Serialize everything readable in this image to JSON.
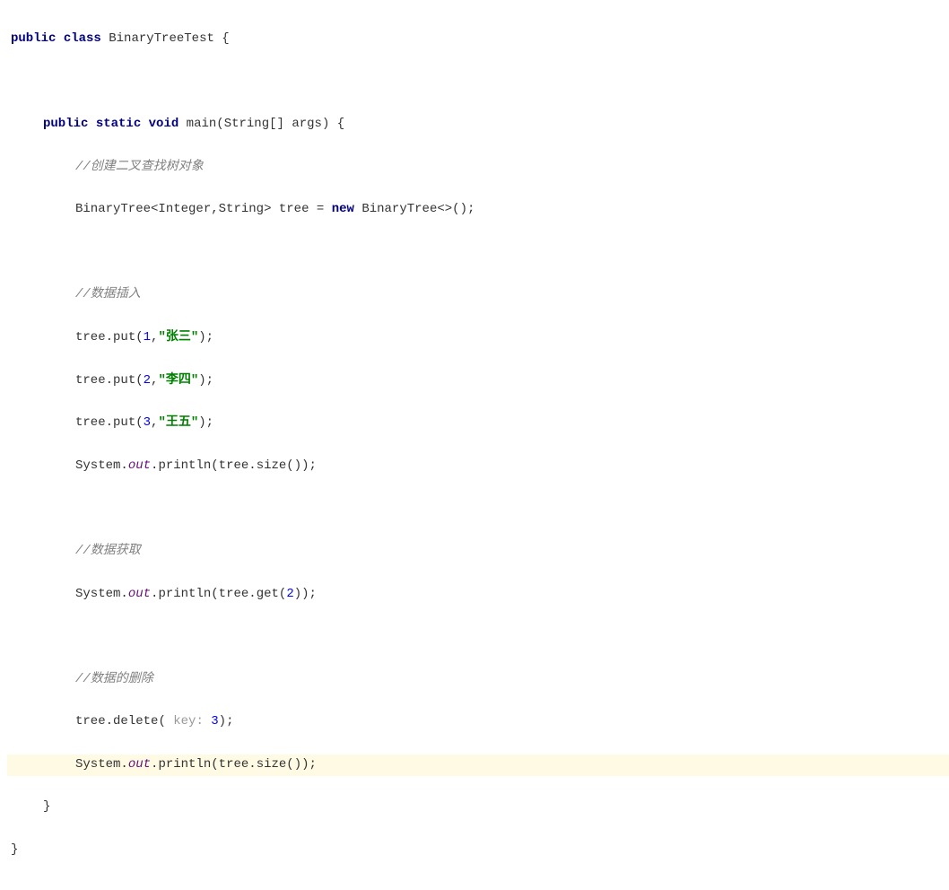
{
  "kw": {
    "public": "public",
    "class": "class",
    "static": "static",
    "void": "void",
    "new": "new"
  },
  "cls": {
    "name": "BinaryTreeTest",
    "bt": "BinaryTree",
    "integer": "Integer",
    "string": "String",
    "sys": "System"
  },
  "method": {
    "main": "main",
    "put": "put",
    "println": "println",
    "size": "size",
    "get": "get",
    "delete": "delete"
  },
  "field": {
    "out": "out"
  },
  "var": {
    "args": "args",
    "tree": "tree"
  },
  "comments": {
    "create": "//创建二叉查找树对象",
    "insert": "//数据插入",
    "fetch": "//数据获取",
    "del": "//数据的删除"
  },
  "strings": {
    "zhang": "\"张三\"",
    "li": "\"李四\"",
    "wang": "\"王五\""
  },
  "nums": {
    "one": "1",
    "two": "2",
    "three": "3"
  },
  "hint": {
    "key": "key:"
  },
  "sym": {
    "lbrace": "{",
    "rbrace": "}",
    "lt": "<",
    "gt": ">",
    "comma": ",",
    "lparen": "(",
    "rparen": ")",
    "semi": ";",
    "dot": ".",
    "sqopen": "[",
    "sqclose": "]",
    "diamond": "<>",
    "eq": " = "
  }
}
